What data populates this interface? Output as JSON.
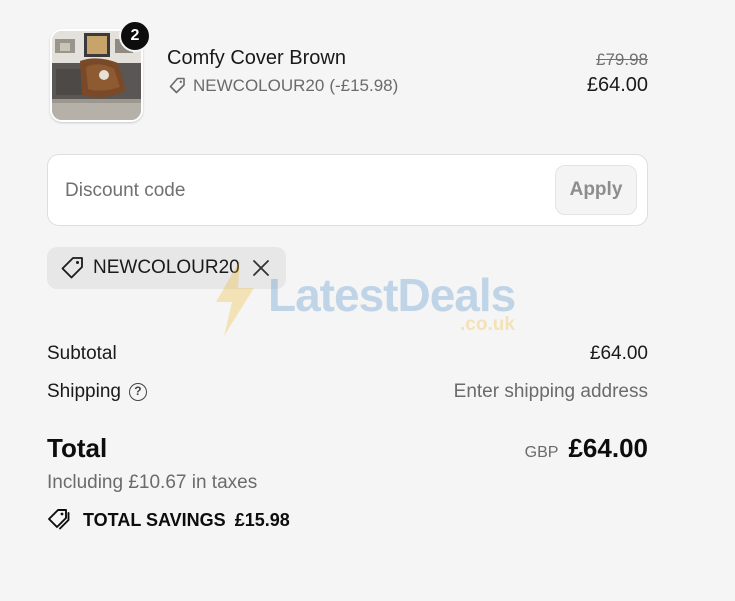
{
  "product": {
    "quantity": "2",
    "name": "Comfy Cover Brown",
    "discount_code": "NEWCOLOUR20",
    "discount_amount": "(-£15.98)",
    "original_price": "£79.98",
    "price": "£64.00",
    "thumbnail_icon": "product-thumbnail"
  },
  "discount": {
    "placeholder": "Discount code",
    "value": "",
    "apply_label": "Apply"
  },
  "applied_code": {
    "label": "NEWCOLOUR20",
    "tag_icon": "tag-icon",
    "remove_icon": "close-icon"
  },
  "watermark": {
    "brand": "LatestDeals",
    "domain": ".co.uk"
  },
  "summary": {
    "subtotal_label": "Subtotal",
    "subtotal_value": "£64.00",
    "shipping_label": "Shipping",
    "shipping_help_icon": "question-circle-icon",
    "shipping_value": "Enter shipping address",
    "total_label": "Total",
    "currency": "GBP",
    "total_value": "£64.00",
    "tax_line": "Including £10.67 in taxes",
    "savings_label": "TOTAL SAVINGS",
    "savings_value": "£15.98"
  },
  "colors": {
    "background": "#f5f5f5",
    "text": "#1a1a1a",
    "muted": "#6b6b6b",
    "badge": "#0d0d0d",
    "chip": "#e7e7e7"
  }
}
